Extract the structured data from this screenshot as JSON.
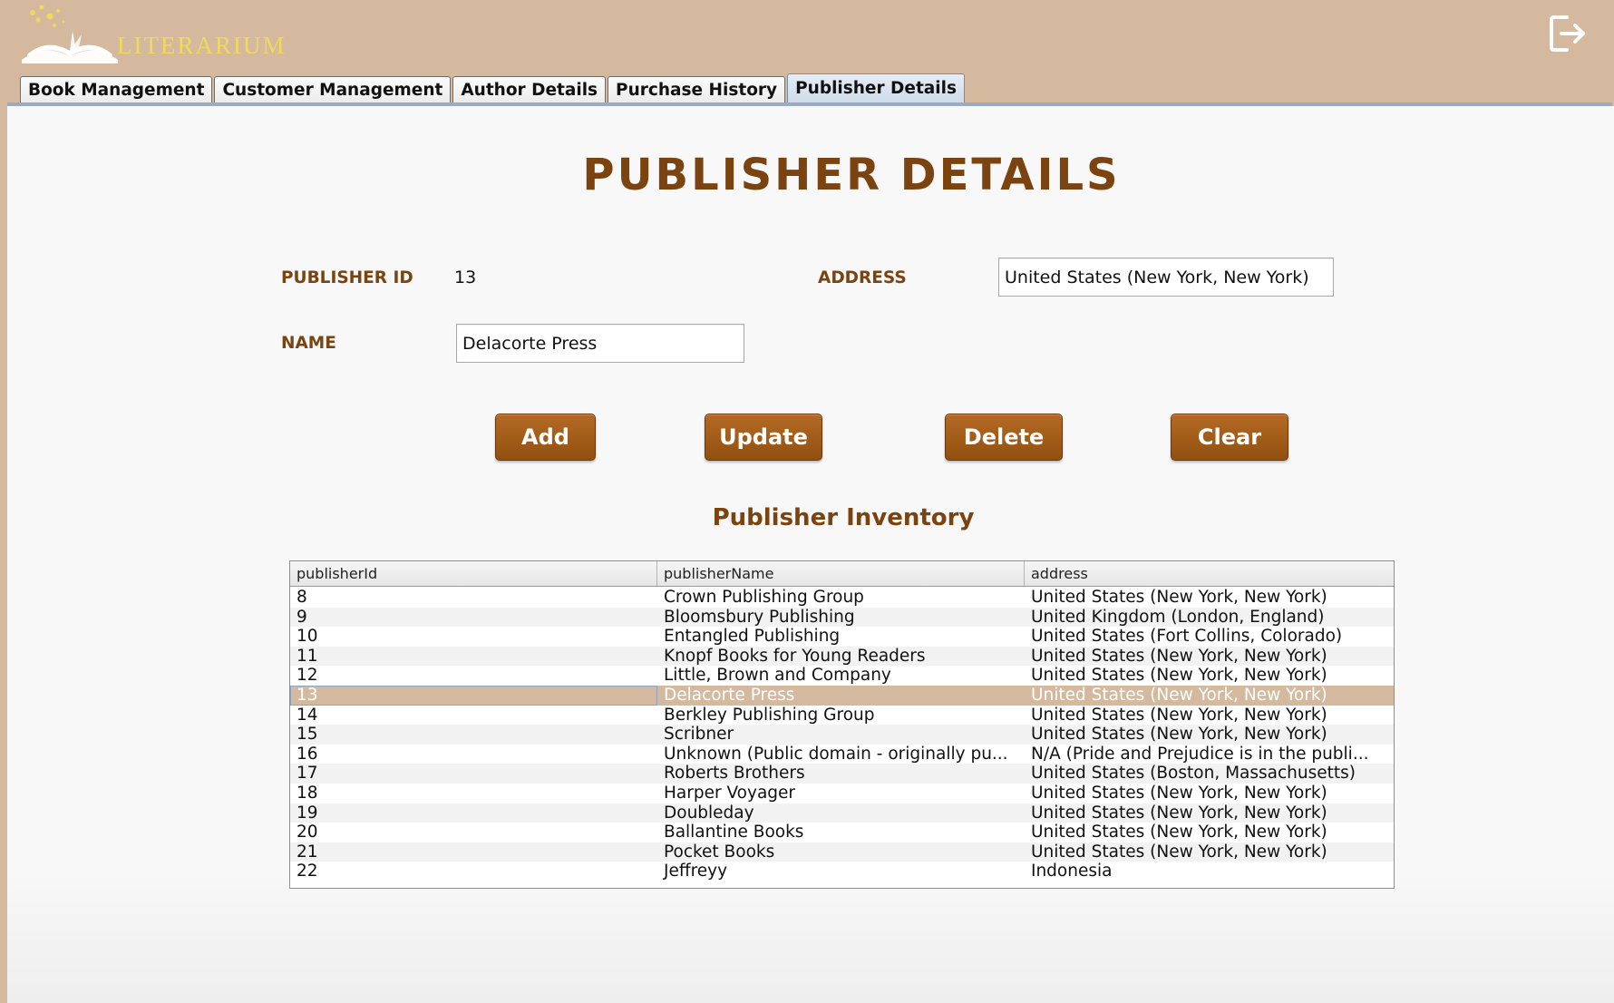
{
  "app": {
    "name": "LITERARIUM"
  },
  "tabs": [
    {
      "label": "Book Management",
      "active": false
    },
    {
      "label": "Customer Management",
      "active": false
    },
    {
      "label": "Author Details",
      "active": false
    },
    {
      "label": "Purchase History",
      "active": false
    },
    {
      "label": "Publisher Details",
      "active": true
    }
  ],
  "page": {
    "title": "PUBLISHER DETAILS"
  },
  "form": {
    "publisher_id_label": "PUBLISHER ID",
    "publisher_id_value": "13",
    "address_label": "ADDRESS",
    "address_value": "United States (New York, New York)",
    "name_label": "NAME",
    "name_value": "Delacorte Press"
  },
  "buttons": {
    "add": "Add",
    "update": "Update",
    "delete": "Delete",
    "clear": "Clear"
  },
  "inventory": {
    "title": "Publisher Inventory",
    "columns": [
      "publisherId",
      "publisherName",
      "address"
    ],
    "selected_row_index": 5,
    "rows": [
      [
        "8",
        "Crown Publishing Group",
        "United States (New York, New York)"
      ],
      [
        "9",
        "Bloomsbury Publishing",
        "United Kingdom (London, England)"
      ],
      [
        "10",
        "Entangled Publishing",
        "United States (Fort Collins, Colorado)"
      ],
      [
        "11",
        "Knopf Books for Young Readers",
        "United States (New York, New York)"
      ],
      [
        "12",
        "Little, Brown and Company",
        "United States (New York, New York)"
      ],
      [
        "13",
        "Delacorte Press",
        "United States (New York, New York)"
      ],
      [
        "14",
        "Berkley Publishing Group",
        "United States (New York, New York)"
      ],
      [
        "15",
        "Scribner",
        "United States (New York, New York)"
      ],
      [
        "16",
        "Unknown (Public domain - originally pu...",
        "N/A (Pride and Prejudice is in the publi..."
      ],
      [
        "17",
        "Roberts Brothers",
        "United States (Boston, Massachusetts)"
      ],
      [
        "18",
        "Harper Voyager",
        "United States (New York, New York)"
      ],
      [
        "19",
        "Doubleday",
        "United States (New York, New York)"
      ],
      [
        "20",
        "Ballantine Books",
        "United States (New York, New York)"
      ],
      [
        "21",
        "Pocket Books",
        "United States (New York, New York)"
      ],
      [
        "22",
        "Jeffreyy",
        "Indonesia"
      ]
    ]
  },
  "icons": {
    "logo": "open-book-logo-icon",
    "logout": "logout-icon"
  },
  "colors": {
    "header_bg": "#d4b99f",
    "accent_brown": "#7a430f",
    "button_bg": "#a25c1a",
    "logo_yellow": "#f2d95a",
    "selected_row": "#d4b99f"
  }
}
